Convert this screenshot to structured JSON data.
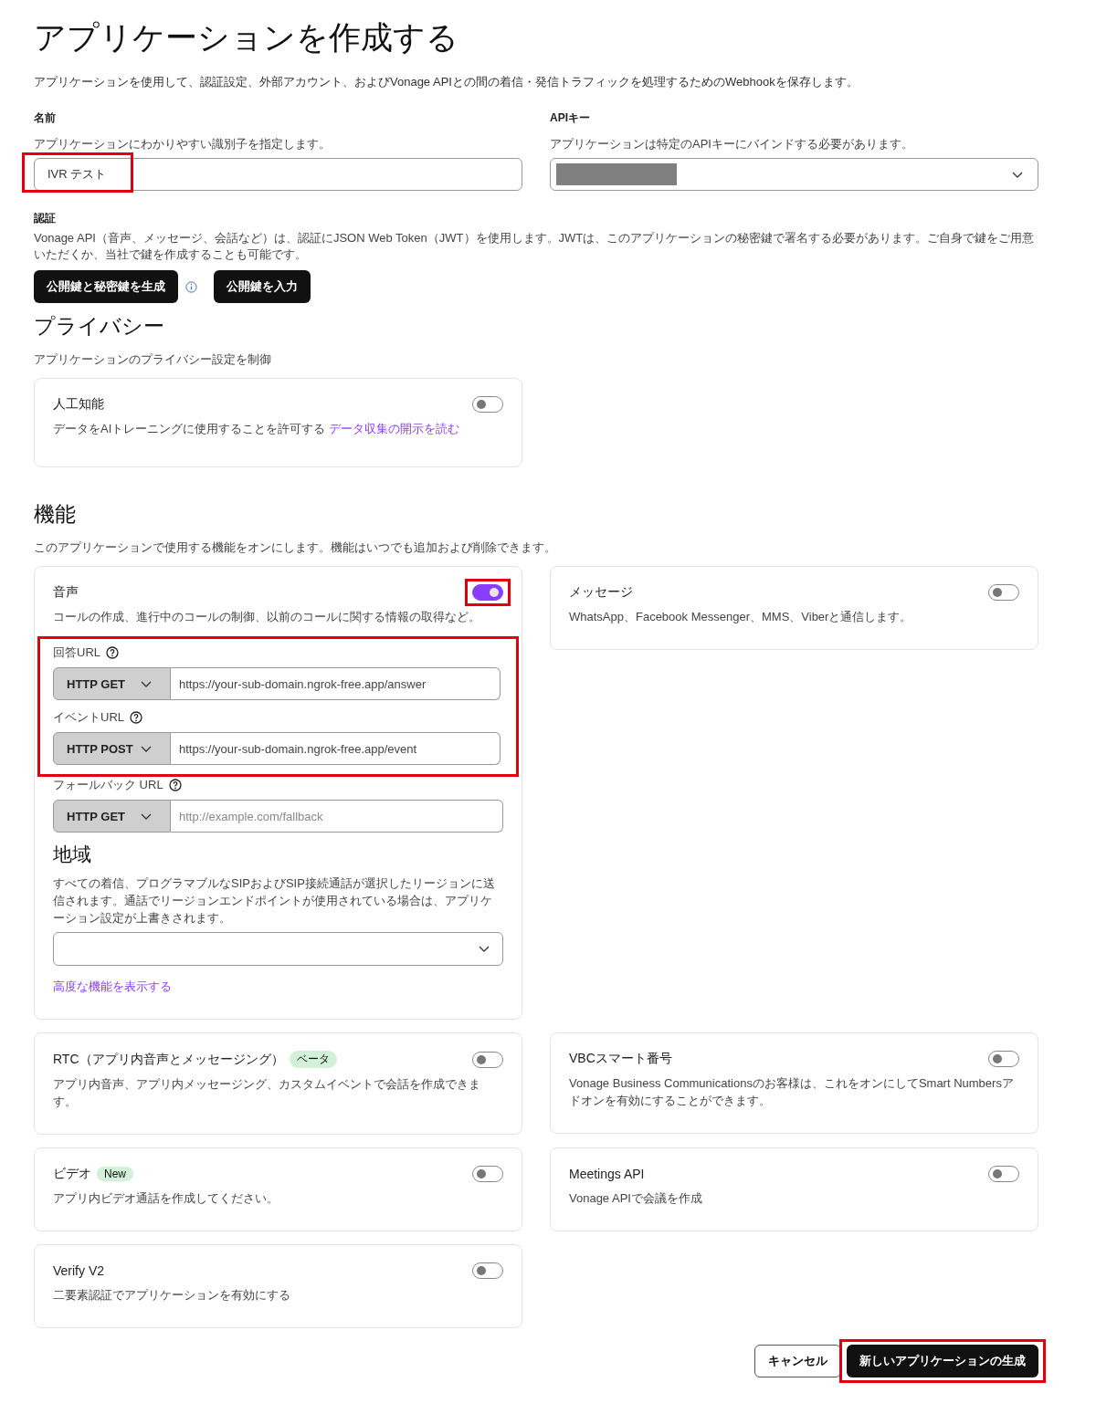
{
  "title": "アプリケーションを作成する",
  "intro": "アプリケーションを使用して、認証設定、外部アカウント、およびVonage APIとの間の着信・発信トラフィックを処理するためのWebhookを保存します。",
  "name_field": {
    "label": "名前",
    "hint": "アプリケーションにわかりやすい識別子を指定します。",
    "value": "IVR テスト",
    "highlighted": true
  },
  "api_key_field": {
    "label": "APIキー",
    "hint": "アプリケーションは特定のAPIキーにバインドする必要があります。"
  },
  "auth": {
    "label": "認証",
    "description": "Vonage API（音声、メッセージ、会話など）は、認証にJSON Web Token（JWT）を使用します。JWTは、このアプリケーションの秘密鍵で署名する必要があります。ご自身で鍵をご用意いただくか、当社で鍵を作成することも可能です。",
    "buttons": [
      "公開鍵と秘密鍵を生成",
      "公開鍵を入力"
    ]
  },
  "privacy": {
    "heading": "プライバシー",
    "description": "アプリケーションのプライバシー設定を制御",
    "card": {
      "title": "人工知能",
      "description": "データをAIトレーニングに使用することを許可する",
      "link": "データ収集の開示を読む",
      "on": false
    }
  },
  "capabilities": {
    "heading": "機能",
    "description": "このアプリケーションで使用する機能をオンにします。機能はいつでも追加および削除できます。",
    "features": [
      {
        "kind": "voice",
        "title": "音声",
        "description": "コールの作成、進行中のコールの制御、以前のコールに関する情報の取得など。",
        "on": true,
        "highlighted": true,
        "urls_highlighted": true,
        "urls": [
          {
            "label": "回答URL",
            "method": "HTTP GET",
            "value": "https://your-sub-domain.ngrok-free.app/answer"
          },
          {
            "label": "イベントURL",
            "method": "HTTP POST",
            "value": "https://your-sub-domain.ngrok-free.app/event"
          },
          {
            "label": "フォールバック URL",
            "method": "HTTP GET",
            "placeholder": "http://example.com/fallback"
          }
        ],
        "region": {
          "heading": "地域",
          "description": "すべての着信、プログラマブルなSIPおよびSIP接続通話が選択したリージョンに送信されます。通話でリージョンエンドポイントが使用されている場合は、アプリケーション設定が上書きされます。"
        },
        "advanced_link": "高度な機能を表示する"
      },
      {
        "kind": "simple",
        "title": "メッセージ",
        "description": "WhatsApp、Facebook Messenger、MMS、Viberと通信します。",
        "on": false
      },
      {
        "kind": "simple",
        "title": "RTC（アプリ内音声とメッセージング）",
        "badge": "ベータ",
        "description": "アプリ内音声、アプリ内メッセージング、カスタムイベントで会話を作成できます。",
        "on": false
      },
      {
        "kind": "simple",
        "title": "VBCスマート番号",
        "description": "Vonage Business Communicationsのお客様は、これをオンにしてSmart Numbersアドオンを有効にすることができます。",
        "on": false
      },
      {
        "kind": "simple",
        "title": "ビデオ",
        "badge": "New",
        "description": "アプリ内ビデオ通話を作成してください。",
        "on": false
      },
      {
        "kind": "simple",
        "title": "Meetings API",
        "description": "Vonage APIで会議を作成",
        "on": false
      },
      {
        "kind": "simple",
        "title": "Verify V2",
        "description": "二要素認証でアプリケーションを有効にする",
        "on": false
      }
    ]
  },
  "footer": {
    "cancel": "キャンセル",
    "create": "新しいアプリケーションの生成",
    "create_highlighted": true
  }
}
